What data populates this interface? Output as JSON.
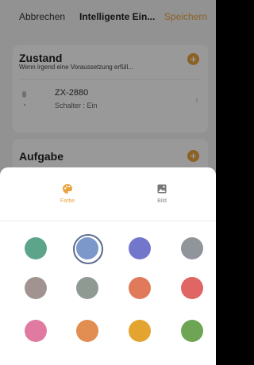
{
  "nav": {
    "cancel": "Abbrechen",
    "title": "Intelligente Ein...",
    "save": "Speichern"
  },
  "condition": {
    "title": "Zustand",
    "subtitle": "Wenn irgend eine Voraussetzung erfüll...",
    "device_name": "ZX-2880",
    "device_status": "Schalter : Ein"
  },
  "task": {
    "title": "Aufgabe"
  },
  "sheet": {
    "tabs": [
      {
        "label": "Farbe",
        "selected": true
      },
      {
        "label": "Bild",
        "selected": false
      }
    ],
    "selected_swatch": 1,
    "swatches": [
      "#5da58a",
      "#7c97c9",
      "#7377cc",
      "#8f959b",
      "#a09390",
      "#8f9a93",
      "#e07a5b",
      "#e06565",
      "#e07aa0",
      "#e28d52",
      "#e3a530",
      "#6ea554"
    ]
  },
  "colors": {
    "accent": "#e8a33d"
  }
}
